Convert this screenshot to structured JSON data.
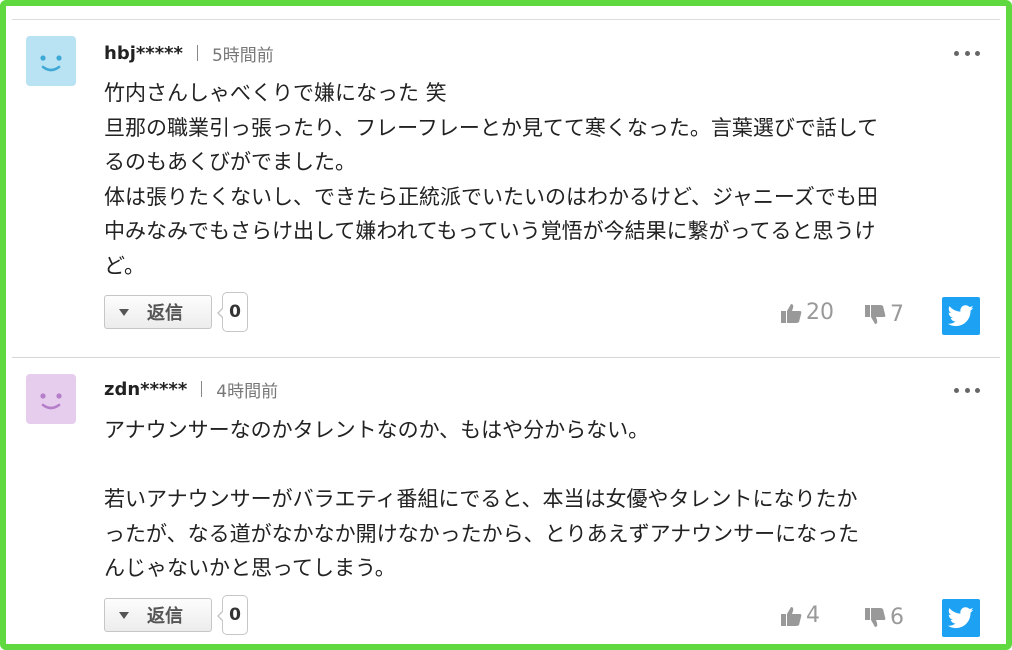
{
  "colors": {
    "frame": "#5fd93f",
    "avatar_blue": "#b9e2f3",
    "avatar_purple": "#e6cdee",
    "twitter": "#1da1f2"
  },
  "comments": [
    {
      "username": "hbj*****",
      "time": "5時間前",
      "avatar_icon": "smiley-face-icon",
      "avatar_color": "#b9e2f3",
      "body": "竹内さんしゃべくりで嫌になった 笑\n旦那の職業引っ張ったり、フレーフレーとか見てて寒くなった。言葉選びで話して\nるのもあくびがでました。\n体は張りたくないし、できたら正統派でいたいのはわかるけど、ジャニーズでも田\n中みなみでもさらけ出して嫌われてもっていう覚悟が今結果に繋がってると思うけ\nど。",
      "reply_label": "返信",
      "reply_count": "0",
      "likes": "20",
      "dislikes": "7"
    },
    {
      "username": "zdn*****",
      "time": "4時間前",
      "avatar_icon": "smiley-face-icon",
      "avatar_color": "#e6cdee",
      "body": "アナウンサーなのかタレントなのか、もはや分からない。\n\n若いアナウンサーがバラエティ番組にでると、本当は女優やタレントになりたか\nったが、なる道がなかなか開けなかったから、とりあえずアナウンサーになった\nんじゃないかと思ってしまう。",
      "reply_label": "返信",
      "reply_count": "0",
      "likes": "4",
      "dislikes": "6"
    }
  ]
}
